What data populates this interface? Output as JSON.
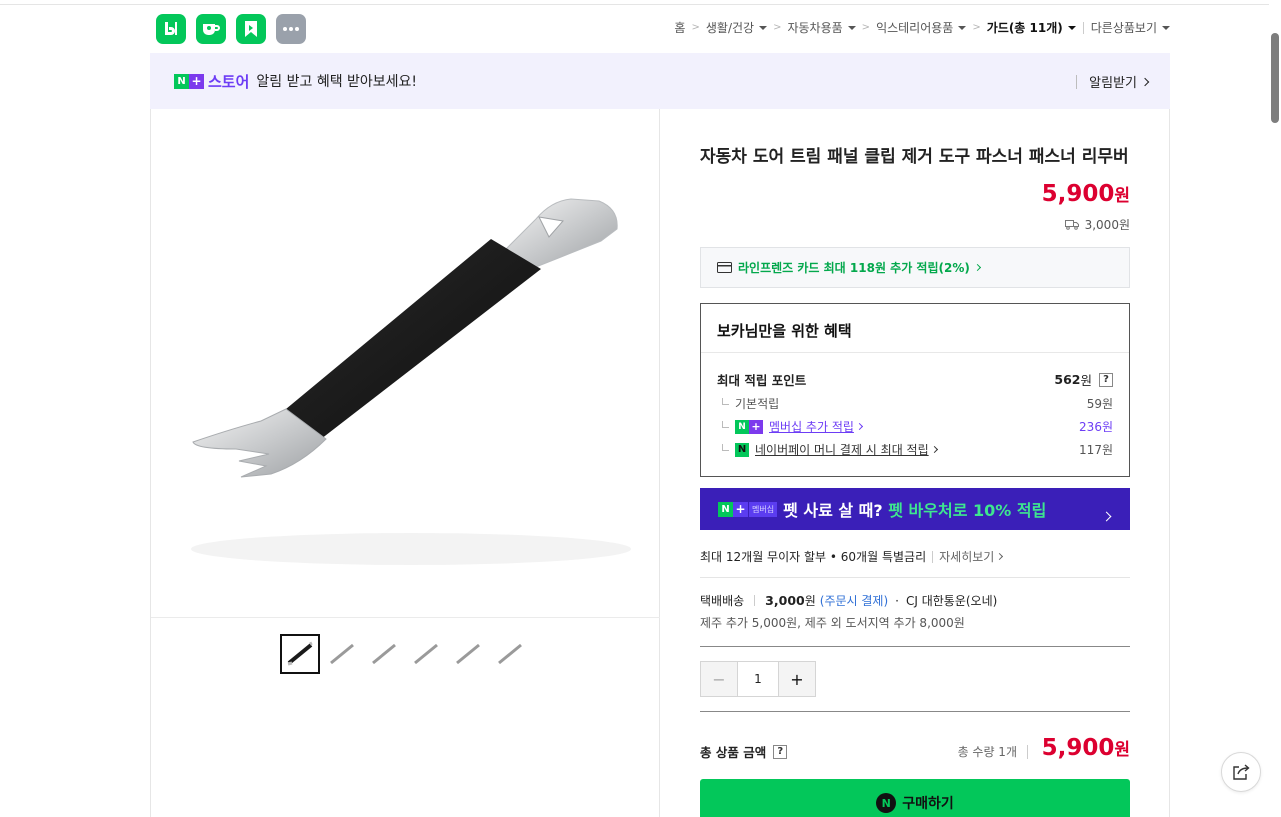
{
  "apps": [
    {
      "name": "blog",
      "icon": "blog-icon"
    },
    {
      "name": "cafe",
      "icon": "cafe-icon"
    },
    {
      "name": "booking",
      "icon": "bookmark-icon"
    },
    {
      "name": "more",
      "icon": "more-icon"
    }
  ],
  "breadcrumb": {
    "home": "홈",
    "items": [
      "생활/건강",
      "자동차용품",
      "익스테리어용품"
    ],
    "current": "가드(총 11개)",
    "other": "다른상품보기"
  },
  "store_banner": {
    "n_badge": "N",
    "plus_badge": "+",
    "store_label": "스토어",
    "message": "알림 받고 혜택 받아보세요!",
    "action": "알림받기"
  },
  "product": {
    "title": "자동차 도어 트림 패널 클립 제거 도구 파스너 패스너 리무버",
    "price": "5,900",
    "price_unit": "원",
    "shipping_fee": "3,000원",
    "thumbnail_count": 6
  },
  "card_benefit": "라인프렌즈 카드 최대 118원 추가 적립(2%)",
  "benefits": {
    "heading": "보카님만을 위한 혜택",
    "max_points_label": "최대 적립 포인트",
    "max_points_value": "562",
    "max_points_unit": "원",
    "help": "?",
    "basic_label": "기본적립",
    "basic_value": "59원",
    "membership_label": "멤버십 추가 적립",
    "membership_value": "236원",
    "npay_badge": "N",
    "npay_label": "네이버페이 머니 결제 시 최대 적립",
    "npay_value": "117원"
  },
  "promo": {
    "badge_text": "멤버십",
    "text_main": "펫 사료 살 때? ",
    "text_highlight": "펫 바우처로 10% 적립"
  },
  "installment": {
    "text": "최대 12개월 무이자 할부 • 60개월 특별금리",
    "detail": "자세히보기"
  },
  "delivery": {
    "method": "택배배송",
    "fee": "3,000",
    "fee_unit": "원",
    "when": "(주문시 결제)",
    "dot": "·",
    "carrier": "CJ 대한통운(오네)",
    "extra": "제주 추가 5,000원, 제주 외 도서지역 추가 8,000원"
  },
  "quantity": {
    "minus": "−",
    "value": "1",
    "plus": "+"
  },
  "total": {
    "label": "총 상품 금액",
    "help": "?",
    "count": "총 수량 1개",
    "amount": "5,900",
    "unit": "원"
  },
  "buy": {
    "badge": "N",
    "label": "구매하기"
  },
  "colors": {
    "naver_green": "#03c75a",
    "price_red": "#dc0030",
    "store_purple": "#6d3df5",
    "promo_bg": "#3a1fb8",
    "banner_bg": "#f2f1fd"
  }
}
